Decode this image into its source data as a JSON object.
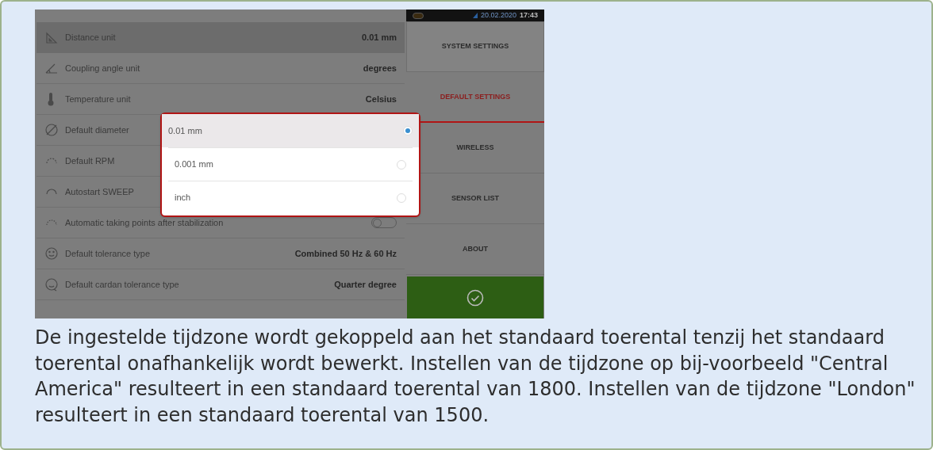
{
  "settings_list": [
    {
      "label": "Distance unit",
      "value": "0.01 mm",
      "kind": "value",
      "selected": true
    },
    {
      "label": "Coupling angle unit",
      "value": "degrees",
      "kind": "value",
      "selected": false
    },
    {
      "label": "Temperature unit",
      "value": "Celsius",
      "kind": "value",
      "selected": false
    },
    {
      "label": "Default diameter",
      "kind": "covered",
      "selected": false
    },
    {
      "label": "Default RPM",
      "kind": "covered",
      "selected": false
    },
    {
      "label": "Autostart SWEEP",
      "kind": "covered",
      "selected": false
    },
    {
      "label": "Automatic taking points after stabilization",
      "kind": "toggle",
      "on": false,
      "selected": false
    },
    {
      "label": "Default tolerance type",
      "value": "Combined 50 Hz & 60 Hz",
      "kind": "value",
      "selected": false
    },
    {
      "label": "Default cardan tolerance type",
      "value": "Quarter degree",
      "kind": "value",
      "selected": false
    }
  ],
  "popup_options": [
    {
      "label": "0.01 mm",
      "selected": true
    },
    {
      "label": "0.001 mm",
      "selected": false
    },
    {
      "label": "inch",
      "selected": false
    }
  ],
  "status_bar": {
    "date": "20.02.2020",
    "time": "17:43"
  },
  "side_menu": [
    {
      "label": "SYSTEM SETTINGS",
      "selected": false
    },
    {
      "label": "DEFAULT SETTINGS",
      "selected": true
    },
    {
      "label": "WIRELESS",
      "selected": false
    },
    {
      "label": "SENSOR LIST",
      "selected": false
    },
    {
      "label": "ABOUT",
      "selected": false
    }
  ],
  "caption": "De ingestelde tijdzone wordt gekoppeld aan het standaard toerental tenzij het standaard toerental onafhankelijk wordt bewerkt. Instellen van de tijdzone op bij-voorbeeld \"Central America\" resulteert in een standaard toerental van 1800. Instellen van de tijdzone \"London\" resulteert in een standaard toerental van 1500."
}
